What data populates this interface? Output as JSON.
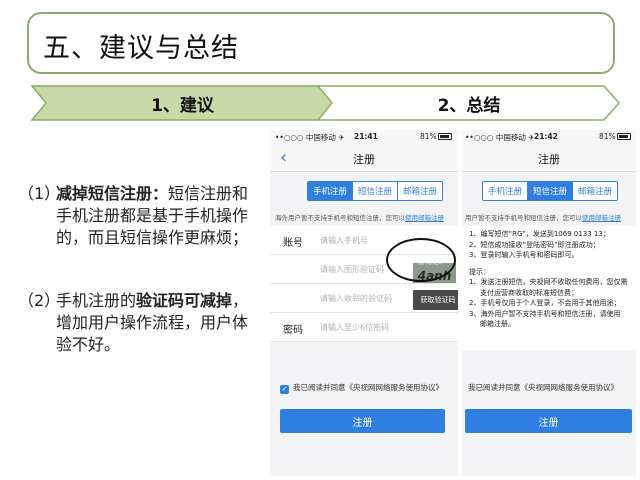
{
  "title": "五、建议与总结",
  "tabs": [
    {
      "label": "1、建议"
    },
    {
      "label": "2、总结"
    }
  ],
  "colors": {
    "accent": "#2f7fe0",
    "green": "#8dab65",
    "green_fill": "#c7d9a6"
  },
  "suggestions": [
    {
      "num": "（1）",
      "bold": "减掉短信注册：",
      "text": "短信注册和手机注册都是基于手机操作的，而且短信操作更麻烦；"
    },
    {
      "num": "（2）",
      "pre": "手机注册的",
      "bold": "验证码可减掉",
      "post": "，增加用户操作流程，用户体验不好。"
    }
  ],
  "phone1": {
    "status": {
      "carrier": "••○○○ 中国移动 ✈",
      "time": "21:41",
      "battery": "81%"
    },
    "nav_title": "注册",
    "tabs": [
      "手机注册",
      "短信注册",
      "邮箱注册"
    ],
    "active_tab": 0,
    "notice": "海外用户暂不支持手机号和短信注册，您可以",
    "notice_link": "使用邮箱注册",
    "fields": [
      {
        "label": "账号",
        "placeholder": "请输入手机号"
      },
      {
        "label": "",
        "placeholder": "请输入图形验证码"
      },
      {
        "label": "",
        "placeholder": "请输入收到的验证码"
      },
      {
        "label": "密码",
        "placeholder": "请输入至少6位密码"
      }
    ],
    "captcha_caption": "图片验证码",
    "captcha_text": "4anh",
    "get_code": "获取验证码",
    "agree": "我已阅读并同意《央视网网络服务使用协议》",
    "register": "注册"
  },
  "phone2": {
    "status": {
      "carrier": "••○○○ 中国移动 ✈",
      "time": "21:42",
      "battery": "81%"
    },
    "nav_title": "注册",
    "tabs": [
      "手机注册",
      "短信注册",
      "邮箱注册"
    ],
    "active_tab": 1,
    "notice": "用户暂不支持手机号和短信注册，您可以",
    "notice_link": "使用邮箱注册",
    "steps": [
      "1、编写短信“RG”，发送到1069 0133 13；",
      "2、短信成功接收“登陆密码”即注册成功；",
      "3、登录时输入手机号和密码即可。"
    ],
    "tips_title": "提示：",
    "tips": [
      "1、发送注册短信，央视网不收取任何费用，您仅需",
      "支付运营商收取的标准短信费；",
      "2、手机号仅用于个人登录，不会用于其他用途；",
      "3、海外用户暂不支持手机号和短信注册，请使用",
      "邮箱注册。"
    ],
    "agree": "我已阅读并同意《央视网网络服务使用协议》",
    "register": "注册"
  }
}
